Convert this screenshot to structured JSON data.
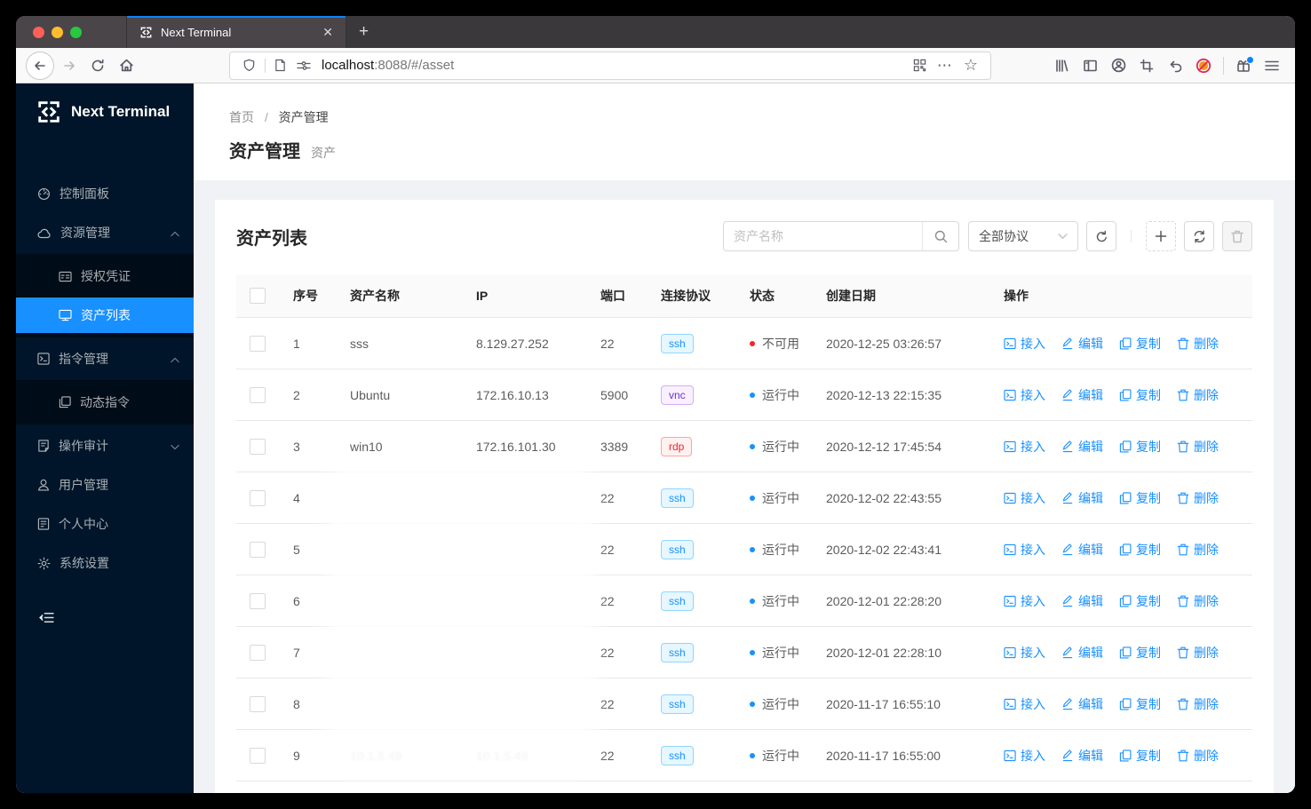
{
  "browser": {
    "tab_title": "Next Terminal",
    "url_host": "localhost",
    "url_rest": ":8088/#/asset",
    "page_actions": "⋯",
    "bookmark_star": "☆"
  },
  "sidebar": {
    "logo_text": "Next Terminal",
    "items": [
      {
        "id": "control-panel",
        "icon": "dashboard-icon",
        "label": "控制面板"
      },
      {
        "id": "resource-mgmt",
        "icon": "cloud-icon",
        "label": "资源管理",
        "chevron": "up"
      },
      {
        "id": "credentials",
        "icon": "idcard-icon",
        "label": "授权凭证",
        "submenu": true
      },
      {
        "id": "asset-list",
        "icon": "desktop-icon",
        "label": "资产列表",
        "submenu": true,
        "selected": true
      },
      {
        "id": "command-mgmt",
        "icon": "code-icon",
        "label": "指令管理",
        "chevron": "up"
      },
      {
        "id": "dynamic-command",
        "icon": "block-icon",
        "label": "动态指令",
        "submenu": true
      },
      {
        "id": "operation-audit",
        "icon": "audit-icon",
        "label": "操作审计",
        "chevron": "down"
      },
      {
        "id": "user-mgmt",
        "icon": "user-icon",
        "label": "用户管理"
      },
      {
        "id": "personal-center",
        "icon": "profile-icon",
        "label": "个人中心"
      },
      {
        "id": "system-settings",
        "icon": "setting-icon",
        "label": "系统设置"
      }
    ]
  },
  "breadcrumb": {
    "home": "首页",
    "sep": "/",
    "current": "资产管理"
  },
  "page": {
    "title": "资产管理",
    "subtitle": "资产"
  },
  "card": {
    "title": "资产列表",
    "search_placeholder": "资产名称",
    "protocol_filter": "全部协议"
  },
  "table": {
    "headers": [
      "序号",
      "资产名称",
      "IP",
      "端口",
      "连接协议",
      "状态",
      "创建日期",
      "操作"
    ],
    "actions": [
      "接入",
      "编辑",
      "复制",
      "删除"
    ],
    "status_colors": {
      "运行中": "#1890ff",
      "不可用": "#f5222d"
    },
    "protocol_styles": {
      "ssh": {
        "color": "#1890ff",
        "bg": "#e6f7ff",
        "border": "#91d5ff"
      },
      "vnc": {
        "color": "#722ed1",
        "bg": "#f9f0ff",
        "border": "#d3adf7"
      },
      "rdp": {
        "color": "#f5222d",
        "bg": "#fff1f0",
        "border": "#ffa39e"
      }
    },
    "rows": [
      {
        "index": "1",
        "name": "sss",
        "ip": "8.129.27.252",
        "port": "22",
        "protocol": "ssh",
        "status": "不可用",
        "date": "2020-12-25 03:26:57"
      },
      {
        "index": "2",
        "name": "Ubuntu",
        "ip": "172.16.10.13",
        "port": "5900",
        "protocol": "vnc",
        "status": "运行中",
        "date": "2020-12-13 22:15:35"
      },
      {
        "index": "3",
        "name": "win10",
        "ip": "172.16.101.30",
        "port": "3389",
        "protocol": "rdp",
        "status": "运行中",
        "date": "2020-12-12 17:45:54"
      },
      {
        "index": "4",
        "name": "",
        "ip": "",
        "port": "22",
        "protocol": "ssh",
        "status": "运行中",
        "date": "2020-12-02 22:43:55",
        "redacted": true
      },
      {
        "index": "5",
        "name": "",
        "ip": "",
        "port": "22",
        "protocol": "ssh",
        "status": "运行中",
        "date": "2020-12-02 22:43:41",
        "redacted": true
      },
      {
        "index": "6",
        "name": "",
        "ip": "",
        "port": "22",
        "protocol": "ssh",
        "status": "运行中",
        "date": "2020-12-01 22:28:20",
        "redacted": true
      },
      {
        "index": "7",
        "name": "",
        "ip": "",
        "port": "22",
        "protocol": "ssh",
        "status": "运行中",
        "date": "2020-12-01 22:28:10",
        "redacted": true
      },
      {
        "index": "8",
        "name": "",
        "ip": "",
        "port": "22",
        "protocol": "ssh",
        "status": "运行中",
        "date": "2020-11-17 16:55:10",
        "redacted": true
      },
      {
        "index": "9",
        "name": "10.1.5.49",
        "ip": "10.1.5.49",
        "port": "22",
        "protocol": "ssh",
        "status": "运行中",
        "date": "2020-11-17 16:55:00",
        "redacted": true,
        "faint": true
      }
    ]
  }
}
